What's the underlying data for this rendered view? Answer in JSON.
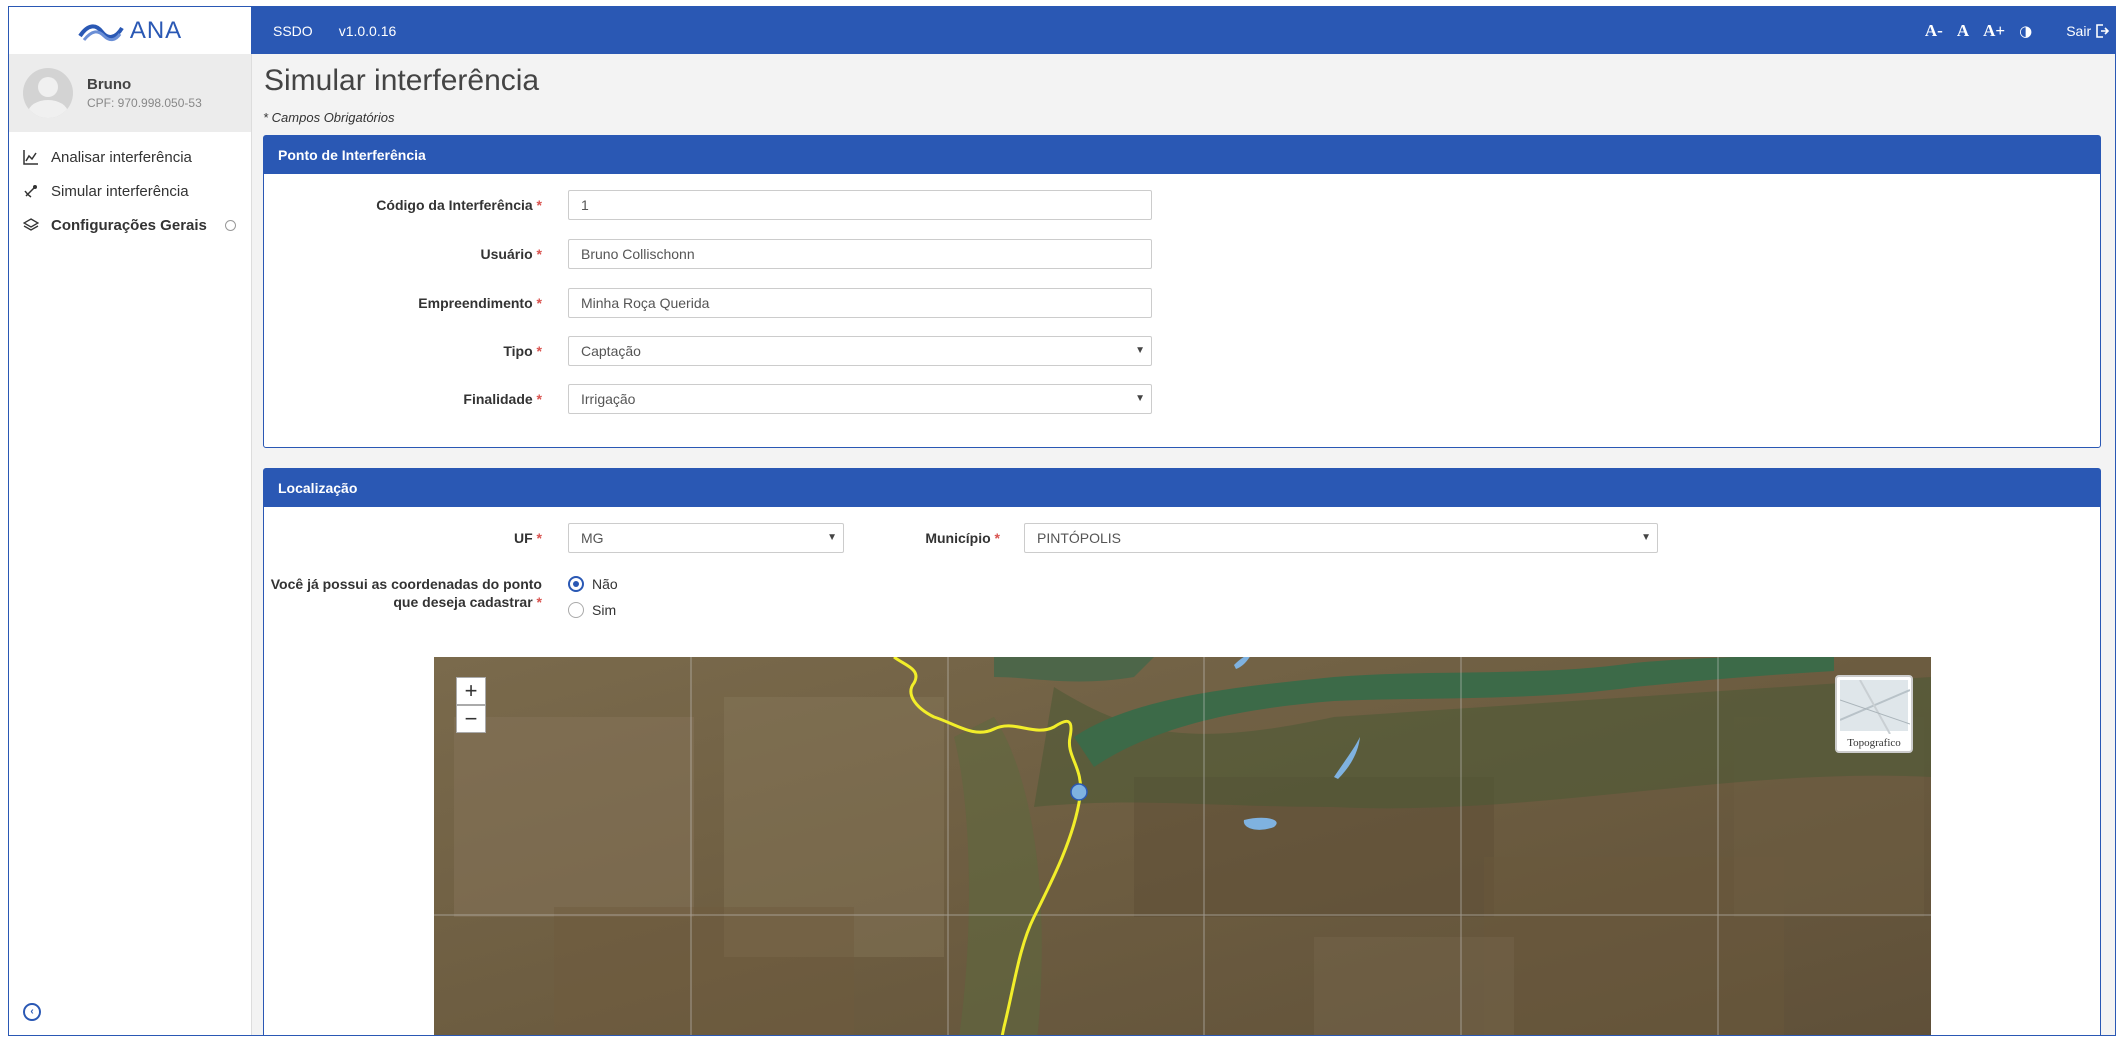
{
  "brand": {
    "logo_text": "ANA"
  },
  "topbar": {
    "app_name": "SSDO",
    "version": "v1.0.0.16",
    "font_decrease": "A-",
    "font_normal": "A",
    "font_increase": "A+",
    "contrast_icon": "◑",
    "logout_label": "Sair"
  },
  "user": {
    "name": "Bruno",
    "cpf": "CPF: 970.998.050-53"
  },
  "sidebar": {
    "items": [
      {
        "label": "Analisar interferência",
        "icon": "chart-line-icon"
      },
      {
        "label": "Simular interferência",
        "icon": "satellite-icon"
      },
      {
        "label": "Configurações Gerais",
        "icon": "layers-icon"
      }
    ]
  },
  "page": {
    "title": "Simular interferência",
    "required_note": "* Campos Obrigatórios"
  },
  "panel_interference": {
    "title": "Ponto de Interferência",
    "fields": [
      {
        "label": "Código da Interferência",
        "value": "1",
        "type": "text"
      },
      {
        "label": "Usuário",
        "value": "Bruno Collischonn",
        "type": "text"
      },
      {
        "label": "Empreendimento",
        "value": "Minha Roça Querida",
        "type": "text"
      },
      {
        "label": "Tipo",
        "value": "Captação",
        "type": "select"
      },
      {
        "label": "Finalidade",
        "value": "Irrigação",
        "type": "select"
      }
    ]
  },
  "panel_location": {
    "title": "Localização",
    "uf_label": "UF",
    "uf_value": "MG",
    "municipio_label": "Município",
    "municipio_value": "PINTÓPOLIS",
    "coords_question_line1": "Você já possui as coordenadas do ponto",
    "coords_question_line2": "que deseja cadastrar",
    "options": [
      {
        "label": "Não",
        "selected": true
      },
      {
        "label": "Sim",
        "selected": false
      }
    ]
  },
  "map": {
    "zoom_in": "+",
    "zoom_out": "−",
    "layer_label": "Topografico",
    "colors": {
      "river": "#3c6a48",
      "boundary": "#f2ee2a",
      "marker": "#7fb2e0"
    }
  },
  "colors": {
    "primary": "#2a58b4",
    "required": "#d9534f"
  }
}
